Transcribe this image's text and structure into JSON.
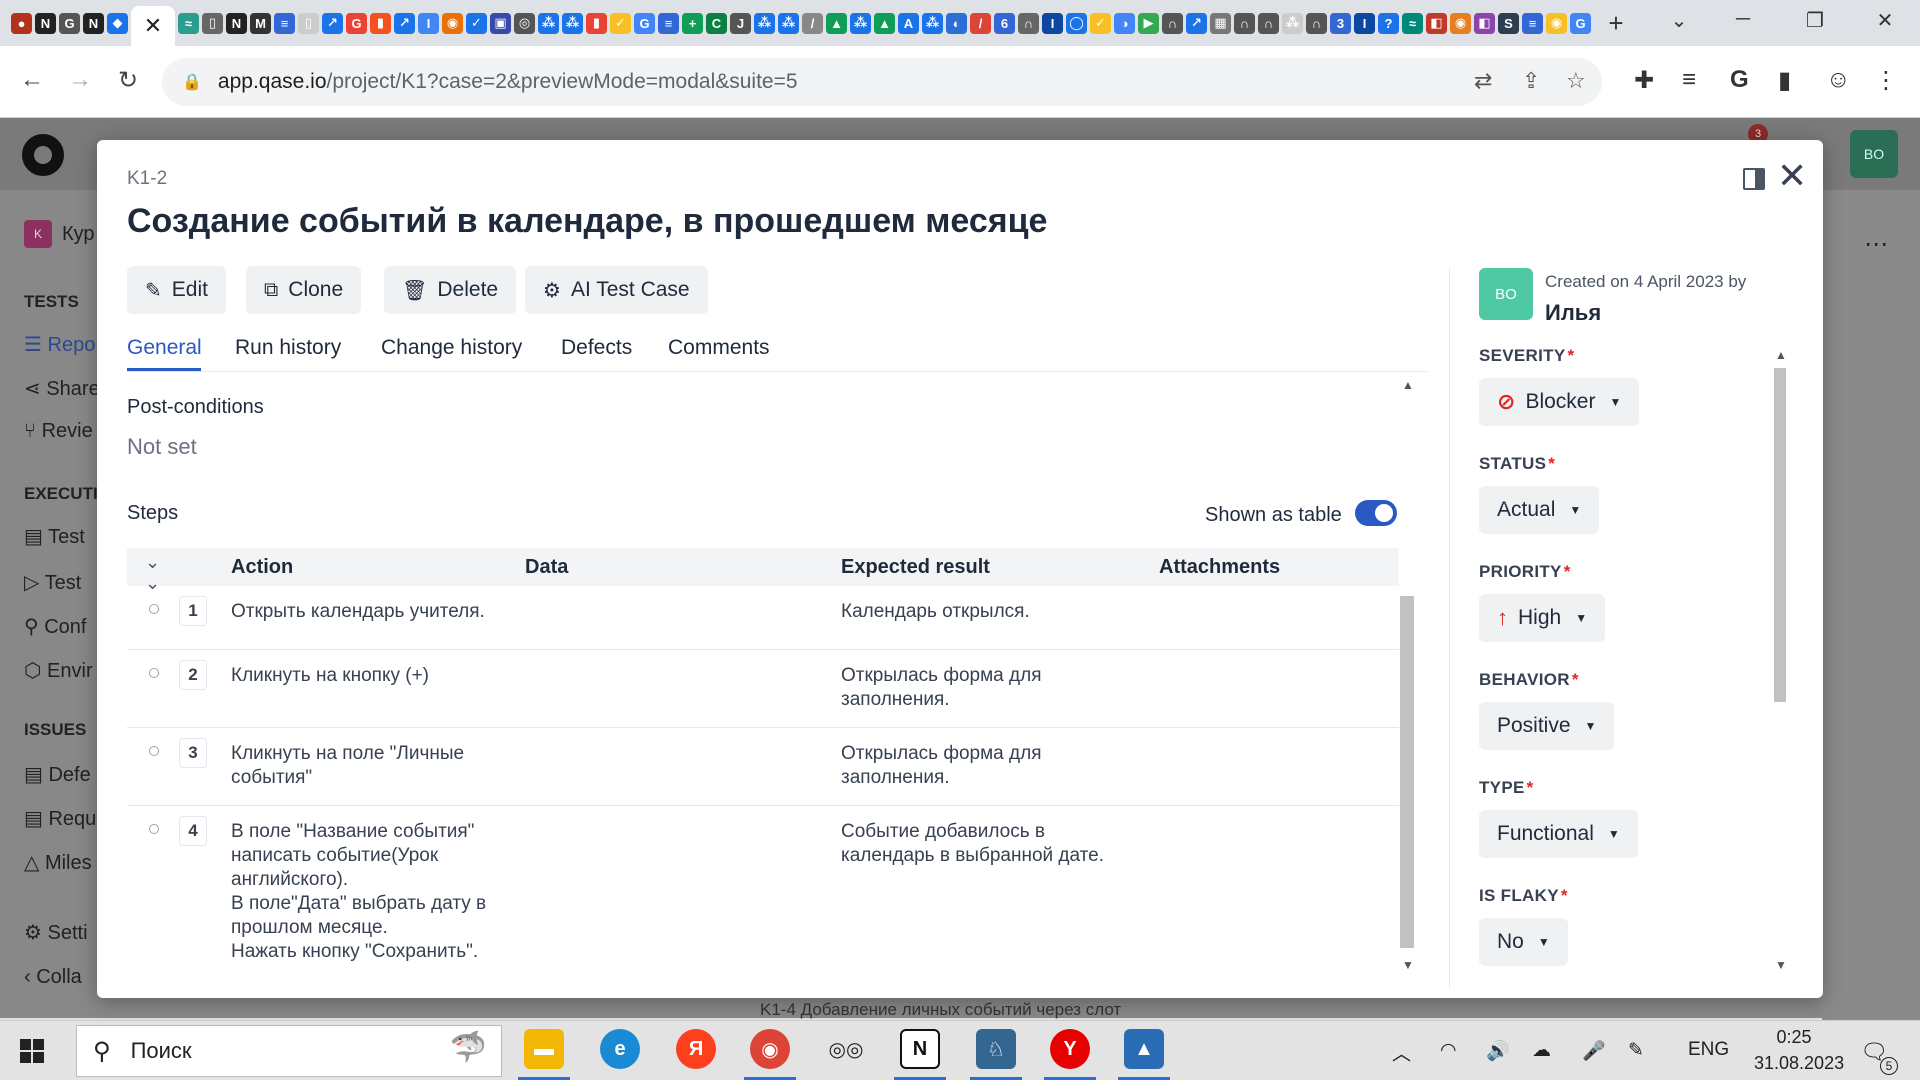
{
  "browser": {
    "url_host": "app.qase.io",
    "url_path": "/project/K1?case=2&previewMode=modal&suite=5"
  },
  "page_behind": {
    "notification_count": "3",
    "avatar_initials": "BO",
    "project_badge": "K",
    "project_name": "Кур",
    "sidebar": {
      "tests_heading": "TESTS",
      "tests_items": [
        "Repo",
        "Share",
        "Revie"
      ],
      "execution_heading": "EXECUTI",
      "execution_items": [
        "Test",
        "Test",
        "Conf",
        "Envir"
      ],
      "issues_heading": "ISSUES",
      "issues_items": [
        "Defe",
        "Requ",
        "Miles"
      ],
      "settings": "Setti",
      "collapse": "Colla"
    },
    "bottom_row": "K1-4   Добавление личных событий через слот"
  },
  "modal": {
    "case_code": "K1-2",
    "title": "Создание событий в календаре, в прошедшем месяце",
    "actions": {
      "edit": "Edit",
      "clone": "Clone",
      "delete": "Delete",
      "ai_test_case": "AI Test Case"
    },
    "tabs": [
      "General",
      "Run history",
      "Change history",
      "Defects",
      "Comments"
    ],
    "post_conditions_label": "Post-conditions",
    "post_conditions_value": "Not set",
    "steps_label": "Steps",
    "shown_as_table_label": "Shown as table",
    "steps_columns": {
      "action": "Action",
      "data": "Data",
      "expected": "Expected result",
      "attachments": "Attachments"
    },
    "steps": [
      {
        "num": "1",
        "action": "Открыть календарь учителя.",
        "expected": "Календарь открылся."
      },
      {
        "num": "2",
        "action": "Кликнуть на кнопку (+)",
        "expected": "Открылась форма для\nзаполнения."
      },
      {
        "num": "3",
        "action": "Кликнуть на поле \"Личные\nсобытия\"",
        "expected": "Открылась форма для\nзаполнения."
      },
      {
        "num": "4",
        "action": "В поле \"Название события\"\nнаписать событие(Урок\nанглийского).\nВ поле\"Дата\" выбрать дату в\nпрошлом месяце.\nНажать кнопку \"Сохранить\".",
        "expected": "Событие добавилось в\nкалендарь в выбранной дате."
      }
    ],
    "properties": {
      "creator_initials": "BO",
      "created_on": "Created on 4 April 2023 by",
      "creator_name": "Илья",
      "severity_label": "SEVERITY",
      "severity_value": "Blocker",
      "status_label": "STATUS",
      "status_value": "Actual",
      "priority_label": "PRIORITY",
      "priority_value": "High",
      "behavior_label": "BEHAVIOR",
      "behavior_value": "Positive",
      "type_label": "TYPE",
      "type_value": "Functional",
      "is_flaky_label": "IS FLAKY",
      "is_flaky_value": "No",
      "required_mark": "*"
    }
  },
  "taskbar": {
    "search_placeholder": "Поиск",
    "language": "ENG",
    "time": "0:25",
    "date": "31.08.2023",
    "notifications": "5"
  },
  "colors": {
    "accent": "#2b59c3",
    "danger": "#dc2626",
    "avatar_green": "#4fc9a4"
  }
}
